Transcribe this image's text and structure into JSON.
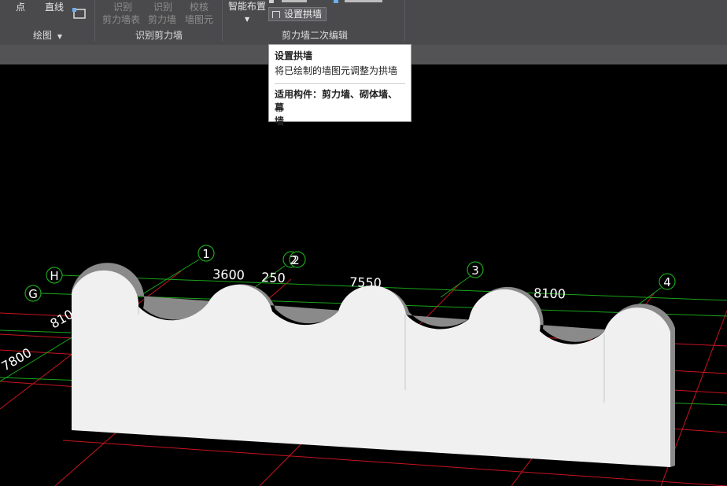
{
  "ribbon": {
    "draw_group": {
      "label": "绘图",
      "point_label": "点",
      "line_label": "直线"
    },
    "identify_group": {
      "label": "识别剪力墙",
      "items": [
        {
          "line1": "识别",
          "line2": "剪力墙表"
        },
        {
          "line1": "识别",
          "line2": "剪力墙"
        },
        {
          "line1": "校核",
          "line2": "墙图元"
        }
      ]
    },
    "edit_group": {
      "label": "剪力墙二次编辑",
      "smart_layout_label": "智能布置",
      "set_arch_wall_label": "设置拱墙"
    }
  },
  "tooltip": {
    "title": "设置拱墙",
    "description": "将已绘制的墙图元调整为拱墙",
    "applicable_line1": "适用构件：剪力墙、砌体墙、幕",
    "applicable_line2": "墙"
  },
  "viewport": {
    "axis_labels": [
      "H",
      "G",
      "1",
      "2",
      "3",
      "4"
    ],
    "dimensions": [
      "3600",
      "250",
      "7550",
      "8100",
      "810",
      "7800"
    ],
    "colors": {
      "background": "#000000",
      "grid": "#c8141e",
      "axis": "#1aa51a",
      "wall": "#f0f0f0",
      "wall_edge": "#909090"
    }
  }
}
